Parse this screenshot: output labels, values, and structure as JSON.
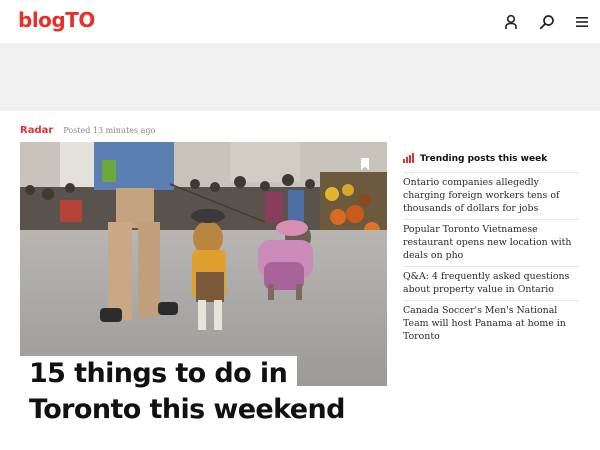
{
  "header": {
    "logo": "blogTO",
    "icons": [
      "account-icon",
      "search-icon",
      "menu-icon"
    ]
  },
  "article": {
    "section": "Radar",
    "posted": "Posted 13 minutes ago",
    "headline_line1": "15 things to do in",
    "headline_line2": "Toronto this weekend",
    "image_icon": "bookmark-icon"
  },
  "trending": {
    "title": "Trending posts this week",
    "icon": "bar-chart-icon",
    "items": [
      "Ontario companies allegedly charging foreign workers tens of thousands of dollars for jobs",
      "Popular Toronto Vietnamese restaurant opens new location with deals on pho",
      "Q&A: 4 frequently asked questions about property value in Ontario",
      "Canada Soccer's Men's National Team will host Panama at home in Toronto"
    ]
  },
  "colors": {
    "brand": "#e4312b",
    "ad_band": "#f0f0f0"
  }
}
